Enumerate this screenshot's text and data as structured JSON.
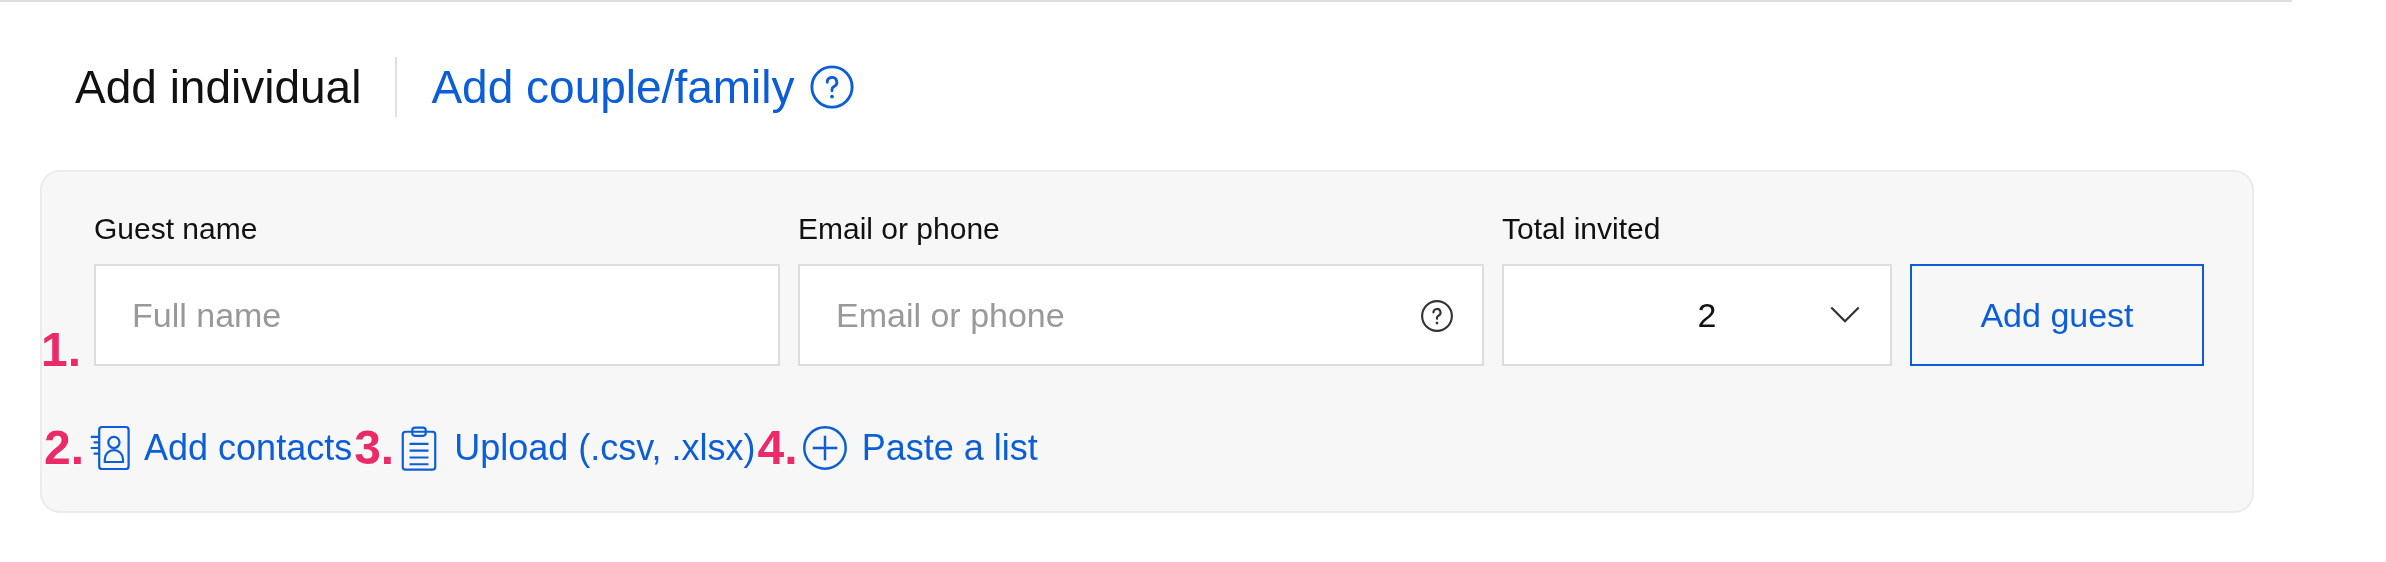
{
  "tabs": [
    {
      "label": "Add individual",
      "selected": true,
      "help": false
    },
    {
      "label": "Add couple/family",
      "selected": false,
      "help": true
    }
  ],
  "form": {
    "fields": [
      {
        "kind": "text",
        "label": "Guest name",
        "placeholder": "Full name",
        "marker": "1.",
        "help": false
      },
      {
        "kind": "text",
        "label": "Email or phone",
        "placeholder": "Email or phone",
        "help": true
      },
      {
        "kind": "select",
        "label": "Total invited",
        "value": "2"
      }
    ],
    "submit": "Add guest"
  },
  "links": [
    {
      "kind": "contacts",
      "marker": "2.",
      "label": "Add contacts"
    },
    {
      "kind": "upload",
      "marker": "3.",
      "label": "Upload (.csv, .xlsx)"
    },
    {
      "kind": "paste",
      "marker": "4.",
      "label": "Paste a list"
    }
  ]
}
